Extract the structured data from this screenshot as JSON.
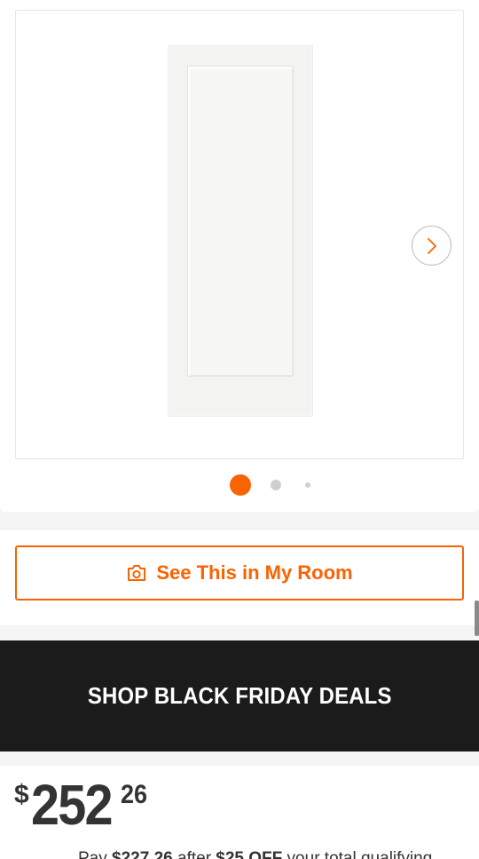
{
  "gallery": {
    "image_alt": "White one-panel interior door",
    "active_slide": 1,
    "slide_count": 3
  },
  "room": {
    "label": "See This in My Room"
  },
  "promo": {
    "label": "SHOP BLACK FRIDAY DEALS"
  },
  "price": {
    "currency": "$",
    "dollars": "252",
    "cents": "26"
  },
  "offer": {
    "prefix": "Pay ",
    "amount": "$227.26",
    "middle": " after ",
    "discount": "$25 OFF",
    "suffix": " your total qualifying"
  },
  "colors": {
    "accent": "#f96302",
    "banner": "#1b1b1b"
  },
  "icons": {
    "next": "chevron-right-icon",
    "room": "camera-icon"
  }
}
